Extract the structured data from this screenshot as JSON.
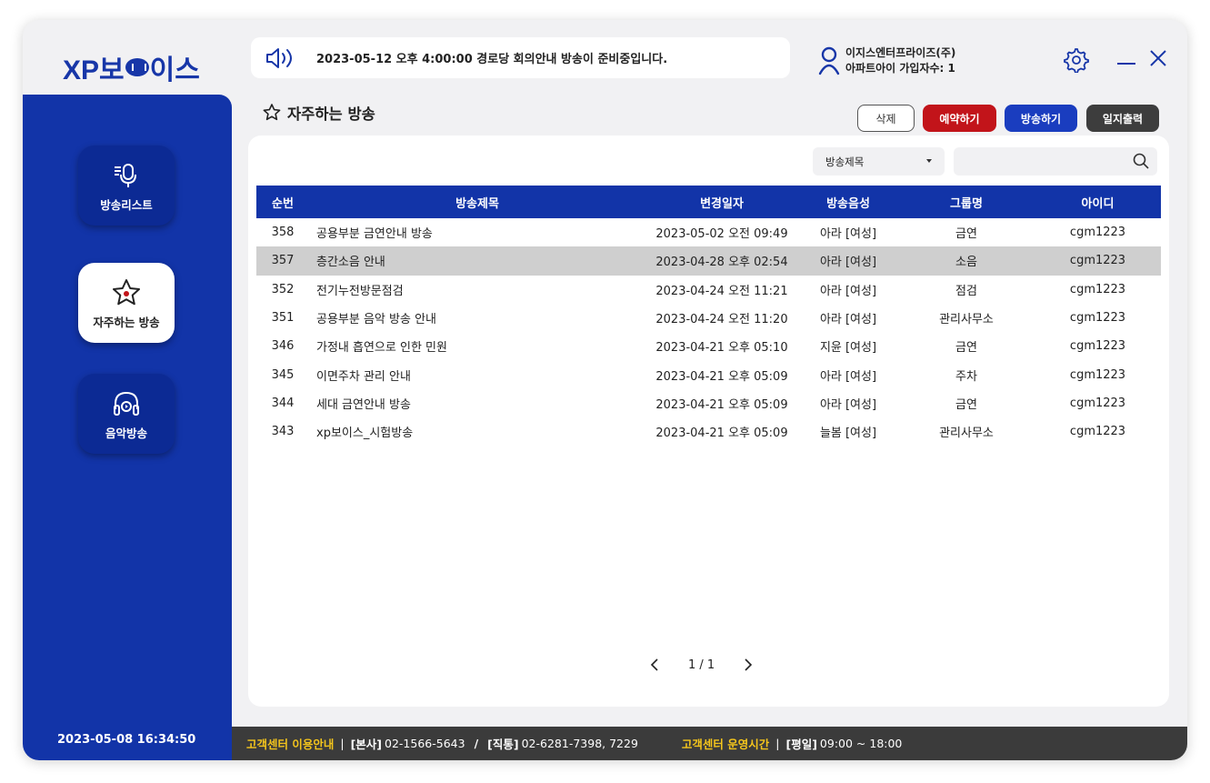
{
  "app": {
    "logo_left": "XP보",
    "logo_right": "이스"
  },
  "notice": {
    "text": "2023-05-12 오후 4:00:00 경로당 회의안내 방송이 준비중입니다."
  },
  "user": {
    "company": "이지스엔터프라이즈(주)",
    "subscribers": "아파트아이 가입자수: 1"
  },
  "sidebar": {
    "items": [
      {
        "label": "방송리스트"
      },
      {
        "label": "자주하는 방송"
      },
      {
        "label": "음악방송"
      }
    ],
    "clock": "2023-05-08 16:34:50"
  },
  "page": {
    "title": "자주하는 방송"
  },
  "toolbar": {
    "delete": "삭제",
    "reserve": "예약하기",
    "broadcast": "방송하기",
    "log": "일지출력"
  },
  "filter": {
    "selected": "방송제목",
    "search_value": ""
  },
  "table": {
    "headers": [
      "순번",
      "방송제목",
      "변경일자",
      "방송음성",
      "그룹명",
      "아이디"
    ],
    "rows": [
      [
        "358",
        "공용부분 금연안내 방송",
        "2023-05-02 오전 09:49",
        "아라 [여성]",
        "금연",
        "cgm1223"
      ],
      [
        "357",
        "층간소음 안내",
        "2023-04-28 오후 02:54",
        "아라 [여성]",
        "소음",
        "cgm1223"
      ],
      [
        "352",
        "전기누전방문점검",
        "2023-04-24 오전 11:21",
        "아라 [여성]",
        "점검",
        "cgm1223"
      ],
      [
        "351",
        "공용부분 음악 방송 안내",
        "2023-04-24 오전 11:20",
        "아라 [여성]",
        "관리사무소",
        "cgm1223"
      ],
      [
        "346",
        "가정내 흡연으로 인한 민원",
        "2023-04-21 오후 05:10",
        "지윤 [여성]",
        "금연",
        "cgm1223"
      ],
      [
        "345",
        "이면주차 관리 안내",
        "2023-04-21 오후 05:09",
        "아라 [여성]",
        "주차",
        "cgm1223"
      ],
      [
        "344",
        "세대 금연안내 방송",
        "2023-04-21 오후 05:09",
        "아라 [여성]",
        "금연",
        "cgm1223"
      ],
      [
        "343",
        "xp보이스_시험방송",
        "2023-04-21 오후 05:09",
        "늘봄 [여성]",
        "관리사무소",
        "cgm1223"
      ]
    ],
    "selected_row": 1
  },
  "pager": {
    "text": "1 / 1"
  },
  "footer": {
    "cs_label": "고객센터 이용안내",
    "sep": "|",
    "hq_label": "[본사]",
    "hq_phone": "02-1566-5643",
    "slash": "/",
    "direct_label": "[직통]",
    "direct_phone": "02-6281-7398, 7229",
    "hours_label": "고객센터 운영시간",
    "weekday_label": "[평일]",
    "weekday_hours": "09:00 ~ 18:00"
  },
  "colors": {
    "brand": "#1234a8",
    "reserve": "#c2141a",
    "broadcast": "#1a3dbf",
    "log": "#3d3d3d",
    "footer_accent": "#f4c51c"
  },
  "icons": {
    "notice": "speaker-icon",
    "user": "user-icon",
    "settings": "gear-icon",
    "minimize": "minimize-icon",
    "close": "close-icon",
    "search": "search-icon"
  }
}
